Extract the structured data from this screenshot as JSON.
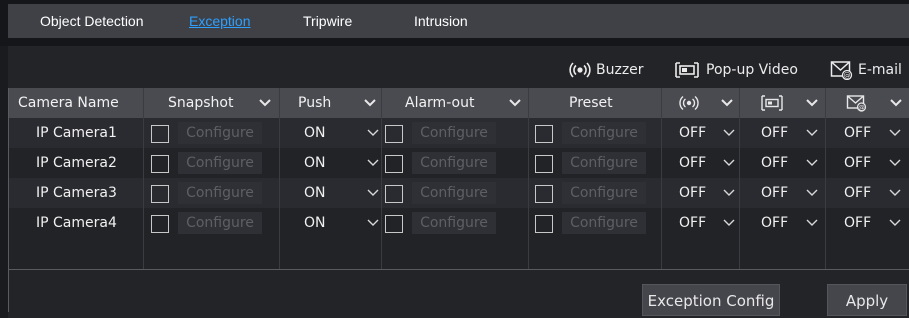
{
  "tabs": [
    {
      "label": "Object Detection",
      "active": false
    },
    {
      "label": "Exception",
      "active": true
    },
    {
      "label": "Tripwire",
      "active": false
    },
    {
      "label": "Intrusion",
      "active": false
    }
  ],
  "legend": {
    "buzzer": "Buzzer",
    "popup_video": "Pop-up Video",
    "email": "E-mail"
  },
  "table": {
    "headers": {
      "camera_name": "Camera Name",
      "snapshot": "Snapshot",
      "push": "Push",
      "alarm_out": "Alarm-out",
      "preset": "Preset"
    },
    "rows": [
      {
        "camera": "IP Camera1",
        "snapshot_checked": false,
        "snapshot_btn": "Configure",
        "push": "ON",
        "alarm_checked": false,
        "alarm_btn": "Configure",
        "preset_checked": false,
        "preset_btn": "Configure",
        "buzzer": "OFF",
        "popup": "OFF",
        "email": "OFF"
      },
      {
        "camera": "IP Camera2",
        "snapshot_checked": false,
        "snapshot_btn": "Configure",
        "push": "ON",
        "alarm_checked": false,
        "alarm_btn": "Configure",
        "preset_checked": false,
        "preset_btn": "Configure",
        "buzzer": "OFF",
        "popup": "OFF",
        "email": "OFF"
      },
      {
        "camera": "IP Camera3",
        "snapshot_checked": false,
        "snapshot_btn": "Configure",
        "push": "ON",
        "alarm_checked": false,
        "alarm_btn": "Configure",
        "preset_checked": false,
        "preset_btn": "Configure",
        "buzzer": "OFF",
        "popup": "OFF",
        "email": "OFF"
      },
      {
        "camera": "IP Camera4",
        "snapshot_checked": false,
        "snapshot_btn": "Configure",
        "push": "ON",
        "alarm_checked": false,
        "alarm_btn": "Configure",
        "preset_checked": false,
        "preset_btn": "Configure",
        "buzzer": "OFF",
        "popup": "OFF",
        "email": "OFF"
      }
    ]
  },
  "footer": {
    "exception_config": "Exception Config",
    "apply": "Apply"
  },
  "colors": {
    "active_tab": "#2ea0ff",
    "panel_bg": "#232428",
    "header_bg": "#4a4b51"
  },
  "icons": {
    "buzzer": "buzzer-icon",
    "popup_video": "popup-video-icon",
    "email": "email-icon",
    "dropdown": "chevron-down-icon"
  }
}
